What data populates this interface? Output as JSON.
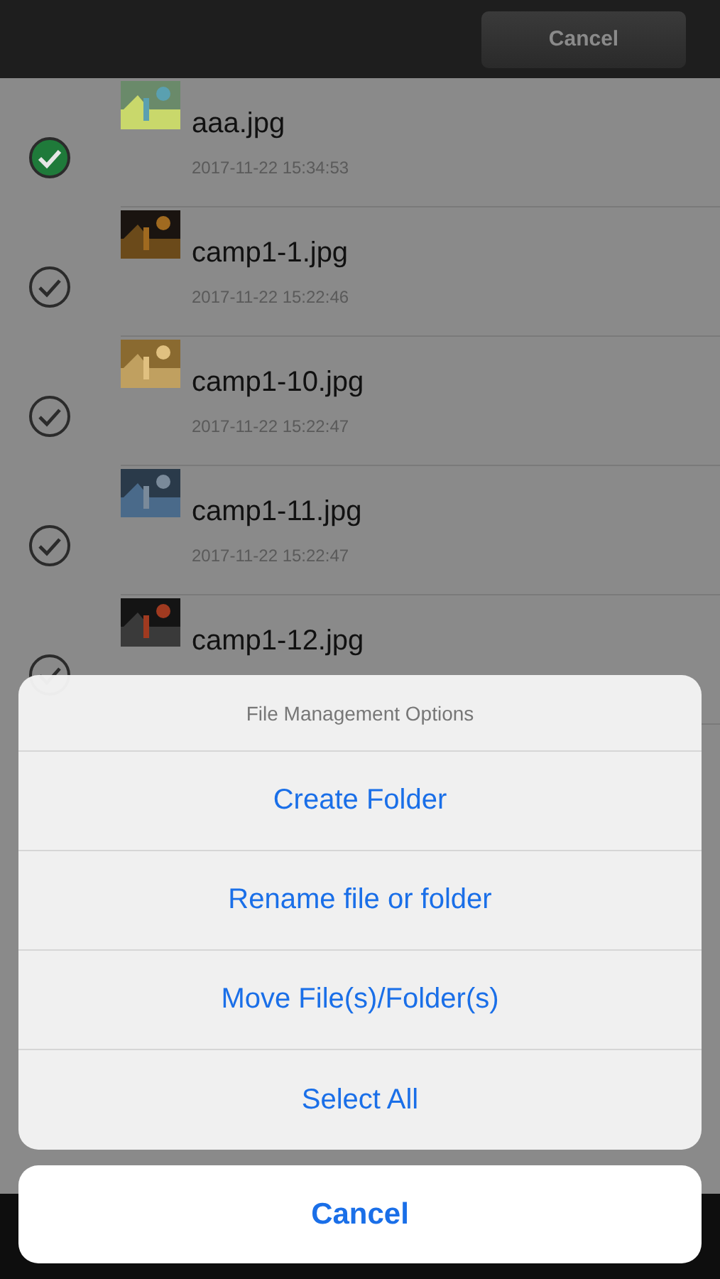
{
  "toolbar": {
    "cancel_button": "Cancel"
  },
  "files": [
    {
      "name": "aaa.jpg",
      "date": "2017-11-22 15:34:53",
      "selected": true
    },
    {
      "name": "camp1-1.jpg",
      "date": "2017-11-22 15:22:46",
      "selected": false
    },
    {
      "name": "camp1-10.jpg",
      "date": "2017-11-22 15:22:47",
      "selected": false
    },
    {
      "name": "camp1-11.jpg",
      "date": "2017-11-22 15:22:47",
      "selected": false
    },
    {
      "name": "camp1-12.jpg",
      "selected": false
    }
  ],
  "action_sheet": {
    "title": "File Management Options",
    "options": [
      "Create Folder",
      "Rename file or folder",
      "Move File(s)/Folder(s)",
      "Select All"
    ],
    "cancel": "Cancel"
  }
}
